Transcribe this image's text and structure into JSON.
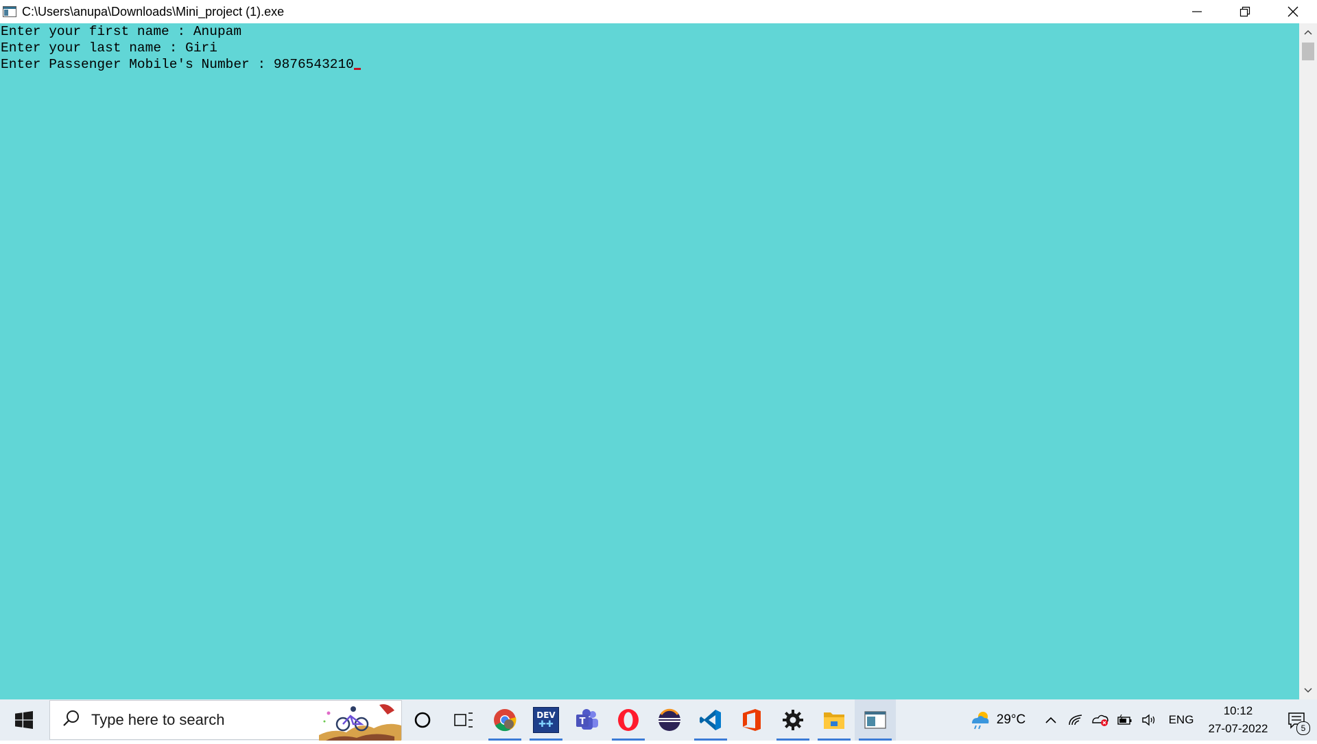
{
  "window": {
    "title": "C:\\Users\\anupa\\Downloads\\Mini_project (1).exe",
    "icon": "console-app-icon"
  },
  "console": {
    "background": "#61d6d6",
    "lines": [
      "Enter your first name : Anupam",
      "Enter your last name : Giri",
      "Enter Passenger Mobile's Number : 9876543210"
    ],
    "cursor_color": "#c50f1f"
  },
  "taskbar": {
    "search_placeholder": "Type here to search",
    "apps": [
      {
        "name": "cortana-icon",
        "active": false
      },
      {
        "name": "task-view-icon",
        "active": false
      },
      {
        "name": "chrome-icon",
        "active": true
      },
      {
        "name": "devcpp-icon",
        "active": true
      },
      {
        "name": "teams-icon",
        "active": false
      },
      {
        "name": "opera-icon",
        "active": true
      },
      {
        "name": "eclipse-icon",
        "active": false
      },
      {
        "name": "vscode-icon",
        "active": true
      },
      {
        "name": "office-icon",
        "active": false
      },
      {
        "name": "settings-icon",
        "active": true
      },
      {
        "name": "file-explorer-icon",
        "active": true
      },
      {
        "name": "console-window-icon",
        "active": true
      }
    ],
    "devcpp_label": "DEV",
    "weather": "29°C",
    "language": "ENG",
    "time": "10:12",
    "date": "27-07-2022",
    "notification_count": "5"
  }
}
